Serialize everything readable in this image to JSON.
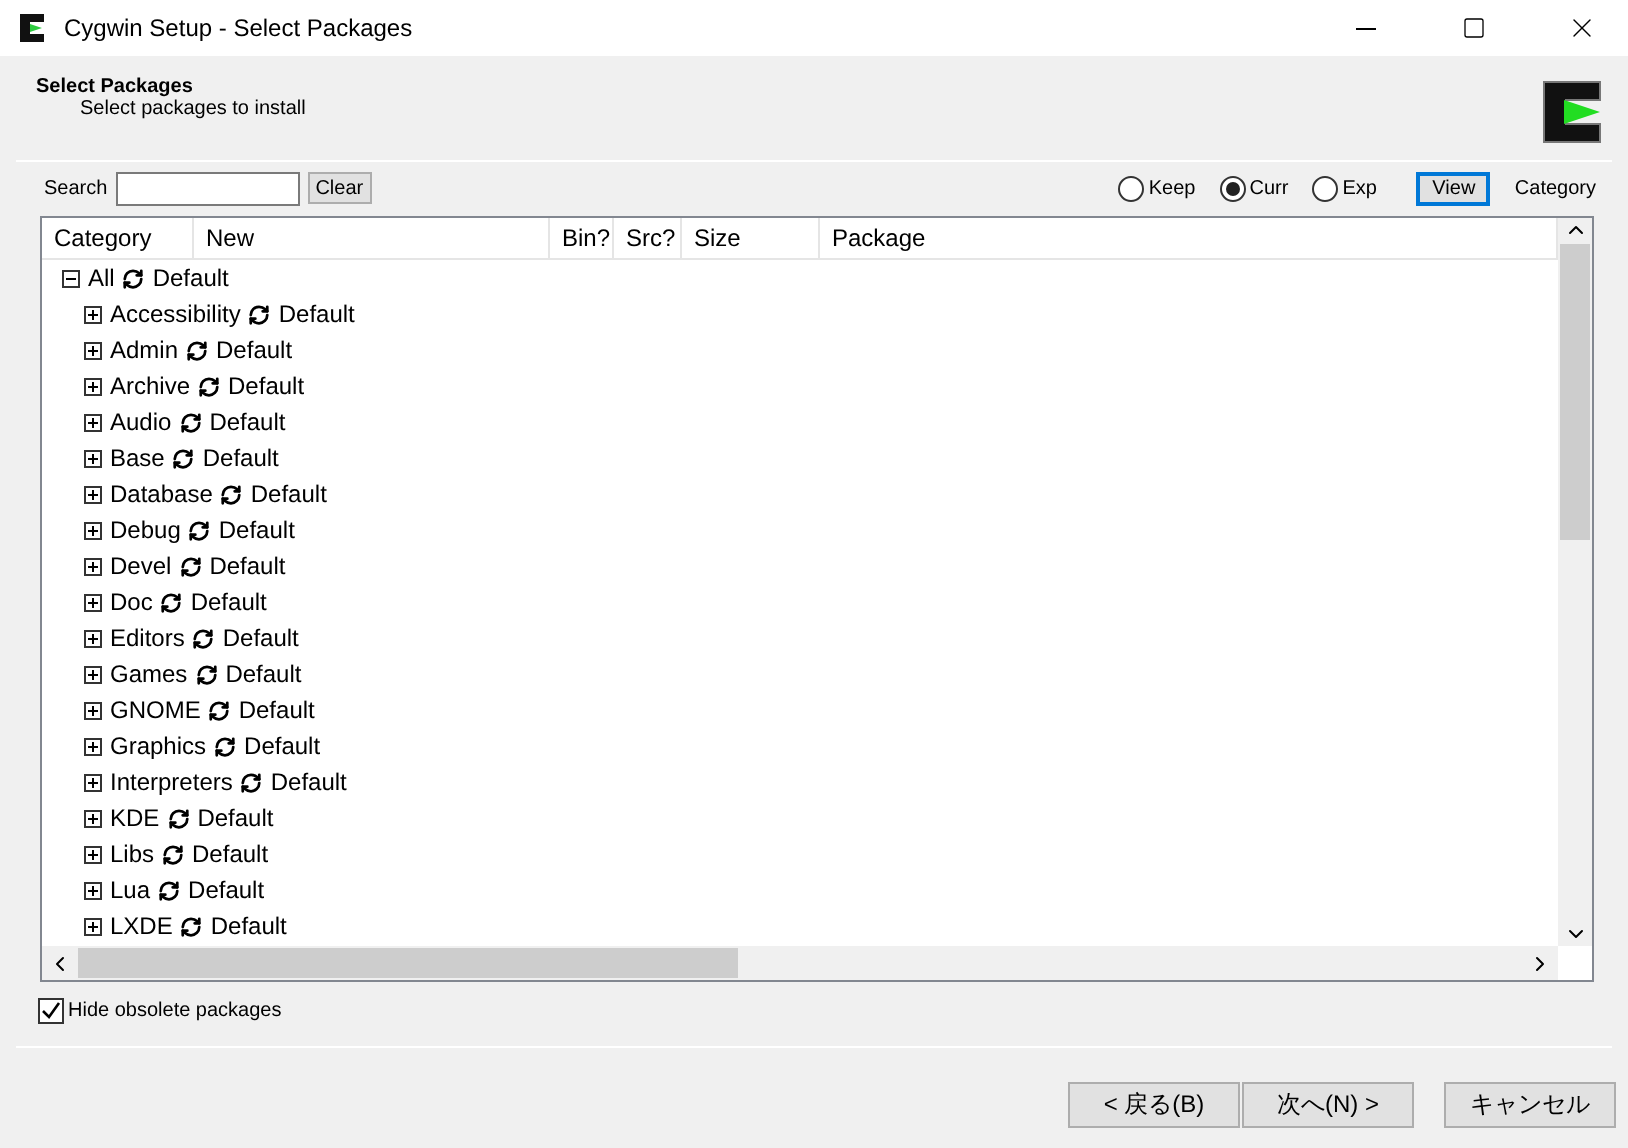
{
  "window": {
    "title": "Cygwin Setup - Select Packages"
  },
  "header": {
    "title": "Select Packages",
    "subtitle": "Select packages to install"
  },
  "search": {
    "label": "Search",
    "clear": "Clear"
  },
  "view_modes": [
    {
      "label": "Keep",
      "selected": false
    },
    {
      "label": "Curr",
      "selected": true
    },
    {
      "label": "Exp",
      "selected": false
    }
  ],
  "view_button": "View",
  "view_current": "Category",
  "table": {
    "columns": [
      "Category",
      "New",
      "Bin?",
      "Src?",
      "Size",
      "Package"
    ],
    "tree": {
      "label": "All",
      "action": "Default",
      "expanded": true,
      "children": [
        {
          "label": "Accessibility",
          "action": "Default",
          "expanded": false
        },
        {
          "label": "Admin",
          "action": "Default",
          "expanded": false
        },
        {
          "label": "Archive",
          "action": "Default",
          "expanded": false
        },
        {
          "label": "Audio",
          "action": "Default",
          "expanded": false
        },
        {
          "label": "Base",
          "action": "Default",
          "expanded": false
        },
        {
          "label": "Database",
          "action": "Default",
          "expanded": false
        },
        {
          "label": "Debug",
          "action": "Default",
          "expanded": false
        },
        {
          "label": "Devel",
          "action": "Default",
          "expanded": false
        },
        {
          "label": "Doc",
          "action": "Default",
          "expanded": false
        },
        {
          "label": "Editors",
          "action": "Default",
          "expanded": false
        },
        {
          "label": "Games",
          "action": "Default",
          "expanded": false
        },
        {
          "label": "GNOME",
          "action": "Default",
          "expanded": false
        },
        {
          "label": "Graphics",
          "action": "Default",
          "expanded": false
        },
        {
          "label": "Interpreters",
          "action": "Default",
          "expanded": false
        },
        {
          "label": "KDE",
          "action": "Default",
          "expanded": false
        },
        {
          "label": "Libs",
          "action": "Default",
          "expanded": false
        },
        {
          "label": "Lua",
          "action": "Default",
          "expanded": false
        },
        {
          "label": "LXDE",
          "action": "Default",
          "expanded": false
        }
      ]
    }
  },
  "hide_obsolete": {
    "label": "Hide obsolete packages",
    "checked": true
  },
  "buttons": [
    "< 戻る(B)",
    "次へ(N) >",
    "キャンセル"
  ]
}
